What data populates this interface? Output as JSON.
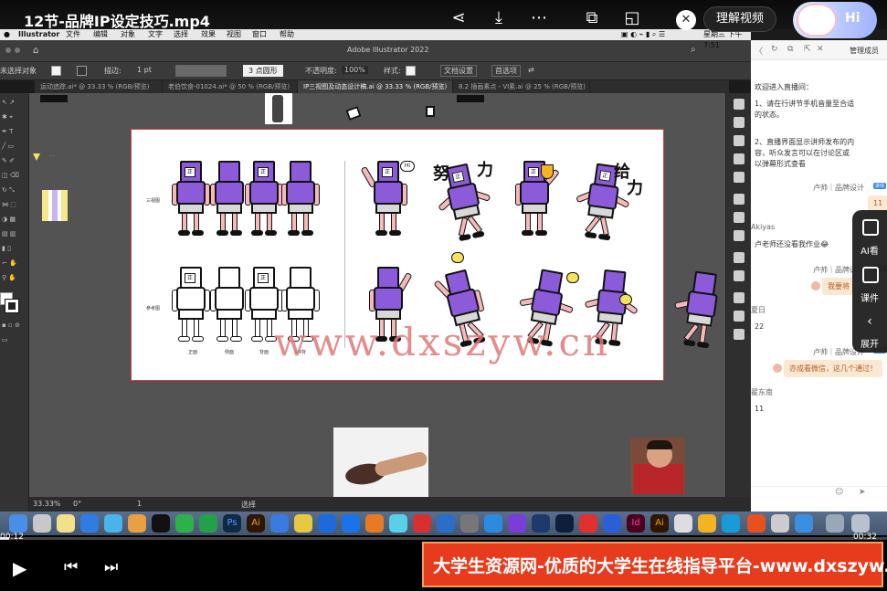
{
  "video": {
    "title": "12节-品牌IP设定技巧.mp4",
    "ai_button": "理解视频",
    "hi_button": "Hi",
    "time_current": "00:12",
    "time_total": "00:32",
    "progress_fraction": 0.01
  },
  "mac_menu": {
    "app": "Illustrator",
    "items": [
      "文件",
      "编辑",
      "对象",
      "文字",
      "选择",
      "效果",
      "视图",
      "窗口",
      "帮助"
    ],
    "clock": "星期三 下午7:51"
  },
  "illustrator": {
    "window_title": "Adobe Illustrator 2022",
    "control": {
      "selection": "未选择对象",
      "stroke_label": "描边:",
      "stroke_value": "1 pt",
      "brush": "3 点圆形",
      "opacity_label": "不透明度:",
      "opacity_value": "100%",
      "style_label": "样式:",
      "doc_settings": "文档设置",
      "preferences": "首选项"
    },
    "tabs": [
      "运动追踪.ai* @ 33.33 % (RGB/预览)",
      "老伯饮食-01024.ai* @ 50 % (RGB/预览)",
      "IP三视图及动态设计稿.ai @ 33.33 % (RGB/预览)",
      "8.2 插画素点 - VI素.ai @ 25 % (RGB/预览)"
    ],
    "active_tab": 2,
    "status": {
      "zoom": "33.33%",
      "angle": "0°",
      "page": "1",
      "tool": "选择"
    },
    "artboard": {
      "row_label_1": "三视图",
      "row_label_2": "参考图",
      "character_labels": [
        "正面",
        "侧面",
        "背面",
        "3/4背"
      ],
      "words": [
        "努",
        "力",
        "给",
        "力"
      ],
      "logo_text": "正",
      "speech": "Hi"
    },
    "watermark": "www.dxszyw.cn"
  },
  "chat": {
    "messages": [
      {
        "text": "欢迎进入直播间："
      },
      {
        "text": "1、请在行讲节手机音量至合适的状态。"
      },
      {
        "text": "2、直播界面显示讲师发布的内容，听众发言可以在讨论区或以弹幕形式查看"
      }
    ],
    "entries": [
      {
        "name": "卢帅｜品牌设计",
        "tag": "讲师",
        "bubble": "11"
      },
      {
        "name": "Akiyas",
        "text": "卢老师还没看我作业😂"
      },
      {
        "name": "卢帅｜品牌设计",
        "tag": "讲师",
        "bubble": "我要将"
      },
      {
        "name": "夏日",
        "text": "22"
      },
      {
        "name": "卢帅｜品牌设计",
        "tag": "讲师",
        "bubble": "亦成看微信，这几个通过！"
      },
      {
        "name": "翟东南",
        "text": "11"
      }
    ],
    "top_label": "管理成员",
    "side_widget": [
      "AI看",
      "课件",
      "展开"
    ]
  },
  "banner": {
    "text": "大学生资源网-优质的大学生在线指导平台-www.dxszyw.cn"
  },
  "colors": {
    "accent_purple": "#8c5bd9",
    "banner_red": "#e63b1d",
    "artboard_border": "#cc4444"
  }
}
